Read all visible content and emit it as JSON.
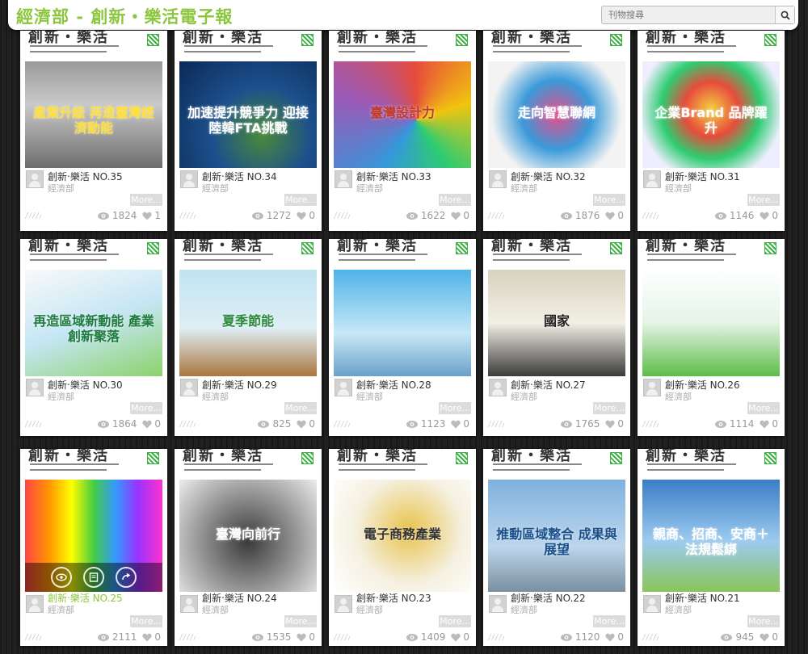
{
  "header": {
    "title": "經濟部 - 創新・樂活電子報",
    "search_placeholder": "刊物搜尋"
  },
  "colors": {
    "brand_green": "#8cc63f",
    "background": "#1f1f1f",
    "card": "#ffffff"
  },
  "publications": [
    {
      "title": "創新‧樂活 NO.35",
      "publisher": "經濟部",
      "more": "More...",
      "views": "1824",
      "likes": "1",
      "cover_text": "產業升級 再造臺灣經濟動能",
      "masthead": "創新・樂活"
    },
    {
      "title": "創新‧樂活 NO.34",
      "publisher": "經濟部",
      "more": "More...",
      "views": "1272",
      "likes": "0",
      "cover_text": "加速提升競爭力 迎接陸韓FTA挑戰",
      "masthead": "創新・樂活"
    },
    {
      "title": "創新‧樂活 NO.33",
      "publisher": "經濟部",
      "more": "More...",
      "views": "1622",
      "likes": "0",
      "cover_text": "臺灣設計力",
      "masthead": "創新・樂活"
    },
    {
      "title": "創新‧樂活 NO.32",
      "publisher": "經濟部",
      "more": "More...",
      "views": "1876",
      "likes": "0",
      "cover_text": "走向智慧聯網",
      "masthead": "創新・樂活"
    },
    {
      "title": "創新‧樂活 NO.31",
      "publisher": "經濟部",
      "more": "More...",
      "views": "1146",
      "likes": "0",
      "cover_text": "企業Brand 品牌躍升",
      "masthead": "創新・樂活"
    },
    {
      "title": "創新‧樂活 NO.30",
      "publisher": "經濟部",
      "more": "More...",
      "views": "1864",
      "likes": "0",
      "cover_text": "再造區域新動能 產業創新聚落",
      "masthead": "創新・樂活"
    },
    {
      "title": "創新‧樂活 NO.29",
      "publisher": "經濟部",
      "more": "More...",
      "views": "825",
      "likes": "0",
      "cover_text": "夏季節能",
      "masthead": "創新・樂活"
    },
    {
      "title": "創新‧樂活 NO.28",
      "publisher": "經濟部",
      "more": "More...",
      "views": "1123",
      "likes": "0",
      "cover_text": "",
      "masthead": "創新・樂活"
    },
    {
      "title": "創新‧樂活 NO.27",
      "publisher": "經濟部",
      "more": "More...",
      "views": "1765",
      "likes": "0",
      "cover_text": "國家",
      "masthead": "創新・樂活"
    },
    {
      "title": "創新‧樂活 NO.26",
      "publisher": "經濟部",
      "more": "More...",
      "views": "1114",
      "likes": "0",
      "cover_text": "",
      "masthead": "創新・樂活"
    },
    {
      "title": "創新‧樂活 NO.25",
      "publisher": "經濟部",
      "more": "More...",
      "views": "2111",
      "likes": "0",
      "cover_text": "",
      "masthead": "創新・樂活"
    },
    {
      "title": "創新‧樂活 NO.24",
      "publisher": "經濟部",
      "more": "More...",
      "views": "1535",
      "likes": "0",
      "cover_text": "臺灣向前行",
      "masthead": "創新・樂活"
    },
    {
      "title": "創新‧樂活 NO.23",
      "publisher": "經濟部",
      "more": "More...",
      "views": "1409",
      "likes": "0",
      "cover_text": "電子商務產業",
      "masthead": "創新・樂活"
    },
    {
      "title": "創新‧樂活 NO.22",
      "publisher": "經濟部",
      "more": "More...",
      "views": "1120",
      "likes": "0",
      "cover_text": "推動區域整合 成果與展望",
      "masthead": "創新・樂活"
    },
    {
      "title": "創新‧樂活 NO.21",
      "publisher": "經濟部",
      "more": "More...",
      "views": "945",
      "likes": "0",
      "cover_text": "親商、招商、安商＋法規鬆綁",
      "masthead": "創新・樂活"
    }
  ]
}
